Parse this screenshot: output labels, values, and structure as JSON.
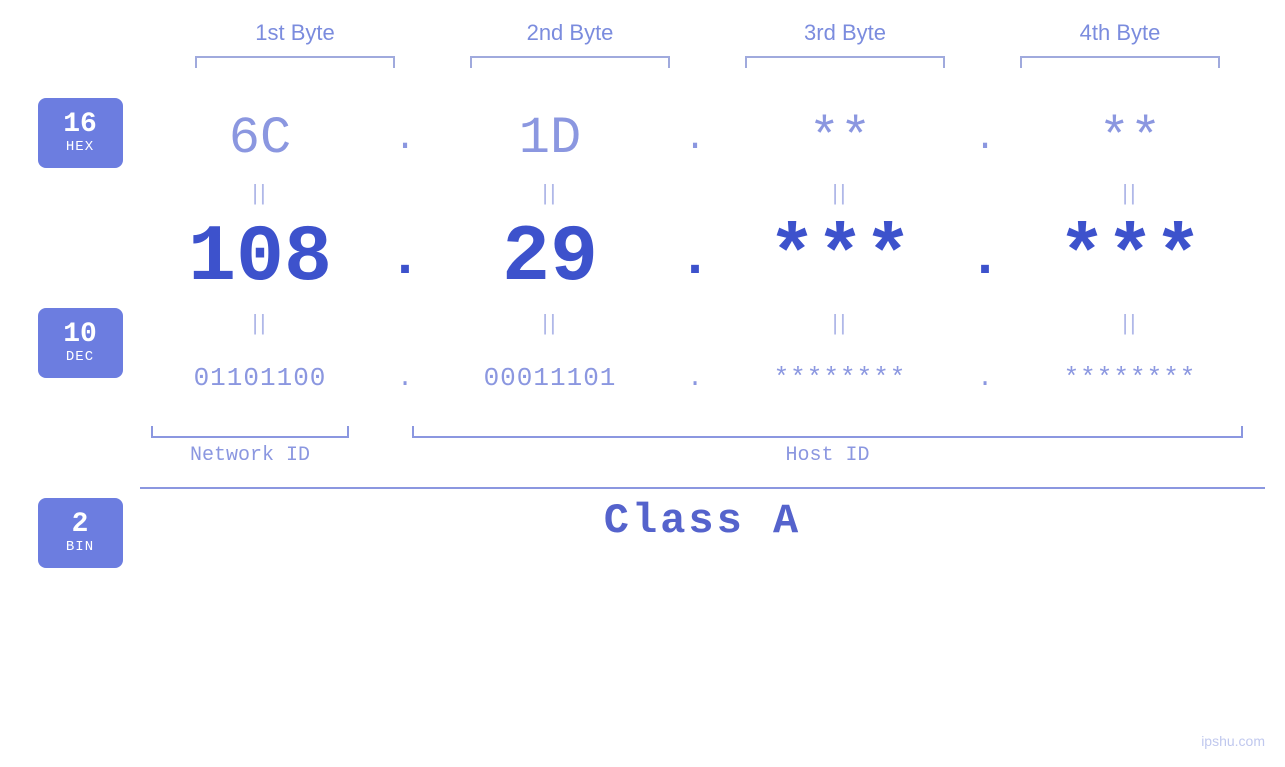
{
  "headers": {
    "byte1": "1st Byte",
    "byte2": "2nd Byte",
    "byte3": "3rd Byte",
    "byte4": "4th Byte"
  },
  "labels": {
    "hex": {
      "num": "16",
      "base": "HEX"
    },
    "dec": {
      "num": "10",
      "base": "DEC"
    },
    "bin": {
      "num": "2",
      "base": "BIN"
    }
  },
  "hex_row": {
    "b1": "6C",
    "b2": "1D",
    "b3": "**",
    "b4": "**",
    "dot": "."
  },
  "dec_row": {
    "b1": "108",
    "b2": "29",
    "b3": "***",
    "b4": "***",
    "dot": "."
  },
  "bin_row": {
    "b1": "01101100",
    "b2": "00011101",
    "b3": "********",
    "b4": "********",
    "dot": "."
  },
  "ids": {
    "network": "Network ID",
    "host": "Host ID"
  },
  "class_label": "Class A",
  "watermark": "ipshu.com"
}
